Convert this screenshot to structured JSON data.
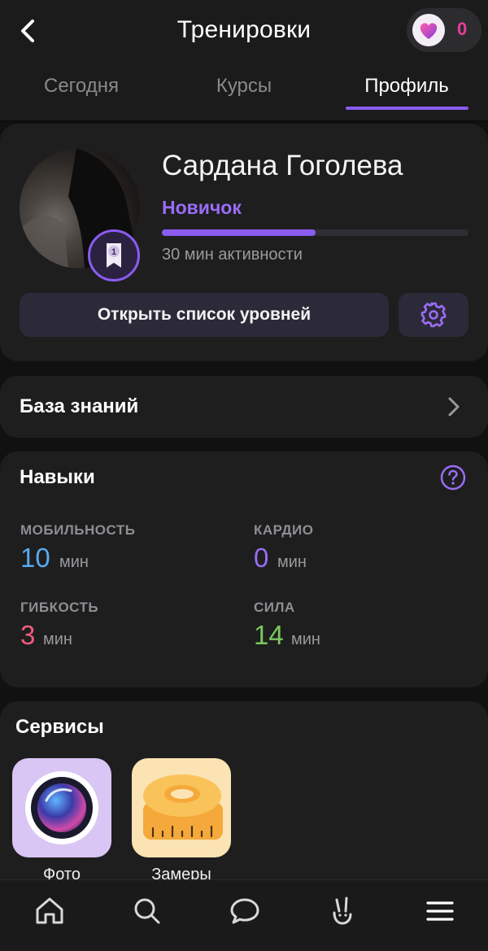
{
  "header": {
    "title": "Тренировки",
    "coins": "0"
  },
  "tabs": [
    {
      "label": "Сегодня",
      "active": false
    },
    {
      "label": "Курсы",
      "active": false
    },
    {
      "label": "Профиль",
      "active": true
    }
  ],
  "profile": {
    "name": "Сардана Гоголева",
    "level": "Новичок",
    "level_badge": "1",
    "progress_fraction": 0.5,
    "activity": "30 мин активности",
    "levels_button": "Открыть список уровней"
  },
  "knowledge_base": {
    "label": "База знаний"
  },
  "skills": {
    "title": "Навыки",
    "items": [
      {
        "label": "МОБИЛЬНОСТЬ",
        "value": "10",
        "unit": "мин",
        "color": "#5aa9f0"
      },
      {
        "label": "КАРДИО",
        "value": "0",
        "unit": "мин",
        "color": "#9a6cf5"
      },
      {
        "label": "ГИБКОСТЬ",
        "value": "3",
        "unit": "мин",
        "color": "#f05c7f"
      },
      {
        "label": "СИЛА",
        "value": "14",
        "unit": "мин",
        "color": "#7bc95a"
      }
    ]
  },
  "services": {
    "title": "Сервисы",
    "items": [
      {
        "label": "Фото",
        "icon": "camera-lens-icon"
      },
      {
        "label": "Замеры",
        "icon": "measuring-tape-icon"
      }
    ]
  },
  "bottom_nav": {
    "items": [
      "home-icon",
      "search-icon",
      "chat-icon",
      "bunny-icon",
      "menu-icon"
    ]
  },
  "colors": {
    "accent": "#8a5cf0",
    "coin": "#e83d9a"
  }
}
